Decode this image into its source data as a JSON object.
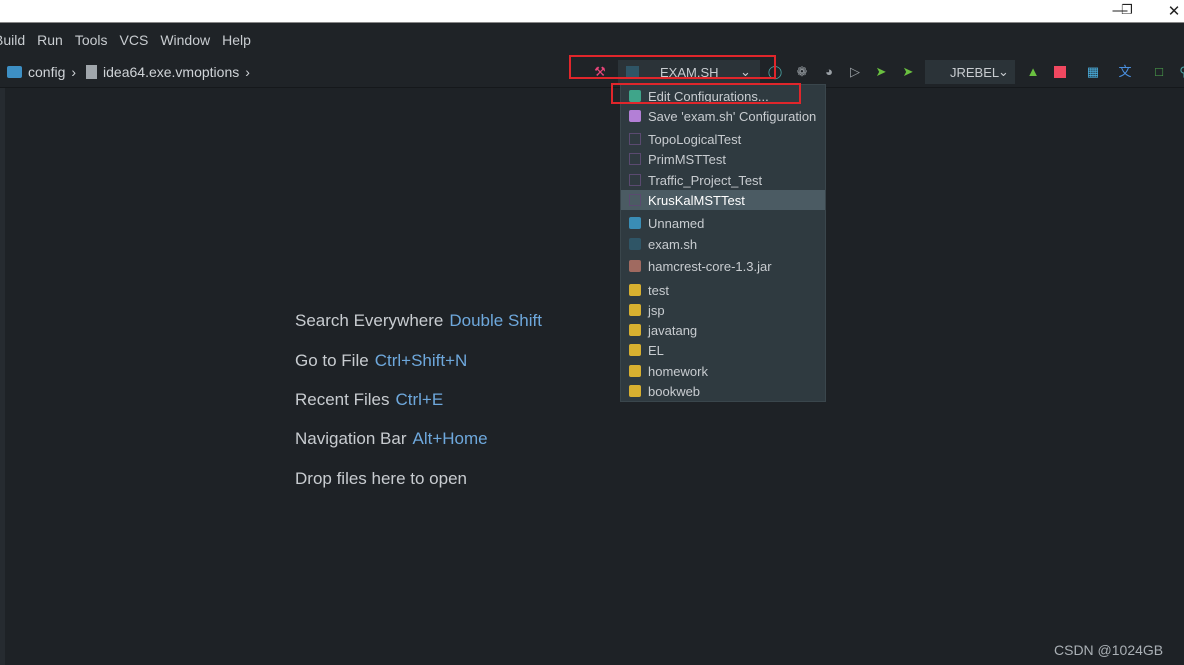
{
  "window": {
    "controls": [
      "minimize",
      "restore",
      "close"
    ]
  },
  "menu": [
    "Build",
    "Run",
    "Tools",
    "VCS",
    "Window",
    "Help"
  ],
  "breadcrumb": [
    {
      "label": "config",
      "icon": "folder-config-icon"
    },
    {
      "label": "idea64.exe.vmoptions",
      "icon": "file-icon"
    }
  ],
  "toolbar": {
    "run_config": "EXAM.SH",
    "jrebel": "JREBEL"
  },
  "popup": {
    "items": [
      {
        "label": "Edit Configurations...",
        "icon": "edit-config-icon",
        "color": "#3fa58a"
      },
      {
        "label": "Save 'exam.sh' Configuration",
        "icon": "save-icon",
        "color": "#b37fd6"
      },
      {
        "label": "TopoLogicalTest",
        "icon": "junit-icon",
        "color": "#5a4a70"
      },
      {
        "label": "PrimMSTTest",
        "icon": "junit-icon",
        "color": "#5a4a70"
      },
      {
        "label": "Traffic_Project_Test",
        "icon": "junit-icon",
        "color": "#5a4a70"
      },
      {
        "label": "KrusKalMSTTest",
        "icon": "junit-icon",
        "color": "#5a4a70",
        "selected": true
      },
      {
        "label": "Unnamed",
        "icon": "shell-error-icon",
        "color": "#3a8db5"
      },
      {
        "label": "exam.sh",
        "icon": "shell-icon",
        "color": "#2f5566"
      },
      {
        "label": "hamcrest-core-1.3.jar",
        "icon": "jar-icon",
        "color": "#a06a60"
      },
      {
        "label": "test",
        "icon": "tomcat-icon",
        "color": "#d8b030"
      },
      {
        "label": "jsp",
        "icon": "tomcat-icon",
        "color": "#d8b030"
      },
      {
        "label": "javatang",
        "icon": "tomcat-icon",
        "color": "#d8b030"
      },
      {
        "label": "EL",
        "icon": "tomcat-icon",
        "color": "#d8b030"
      },
      {
        "label": "homework",
        "icon": "tomcat-icon",
        "color": "#d8b030"
      },
      {
        "label": "bookweb",
        "icon": "tomcat-icon",
        "color": "#d8b030"
      }
    ]
  },
  "hints": [
    {
      "label": "Search Everywhere",
      "key": "Double Shift"
    },
    {
      "label": "Go to File",
      "key": "Ctrl+Shift+N"
    },
    {
      "label": "Recent Files",
      "key": "Ctrl+E"
    },
    {
      "label": "Navigation Bar",
      "key": "Alt+Home"
    },
    {
      "label": "Drop files here to open",
      "key": ""
    }
  ],
  "watermark": "CSDN @1024GB",
  "colors": {
    "highlight": "#e0262b",
    "shortcut": "#6ea8dc",
    "background": "#1e2226"
  }
}
